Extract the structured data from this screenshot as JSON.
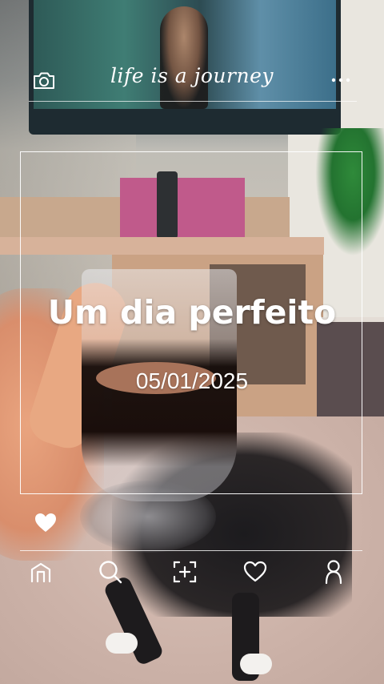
{
  "overlay": {
    "script_title": "life is a journey",
    "headline": "Um dia perfeito",
    "date": "05/01/2025"
  },
  "icons": {
    "top_left": "camera-icon",
    "top_right": "more-horizontal-icon",
    "like": "heart-filled-icon"
  },
  "bottom_nav": [
    {
      "id": "home",
      "icon": "home-icon"
    },
    {
      "id": "search",
      "icon": "search-icon"
    },
    {
      "id": "create",
      "icon": "add-square-icon"
    },
    {
      "id": "activity",
      "icon": "heart-outline-icon"
    },
    {
      "id": "profile",
      "icon": "profile-icon"
    }
  ],
  "colors": {
    "overlay_text": "#ffffff",
    "frame_line": "#ffffff"
  }
}
